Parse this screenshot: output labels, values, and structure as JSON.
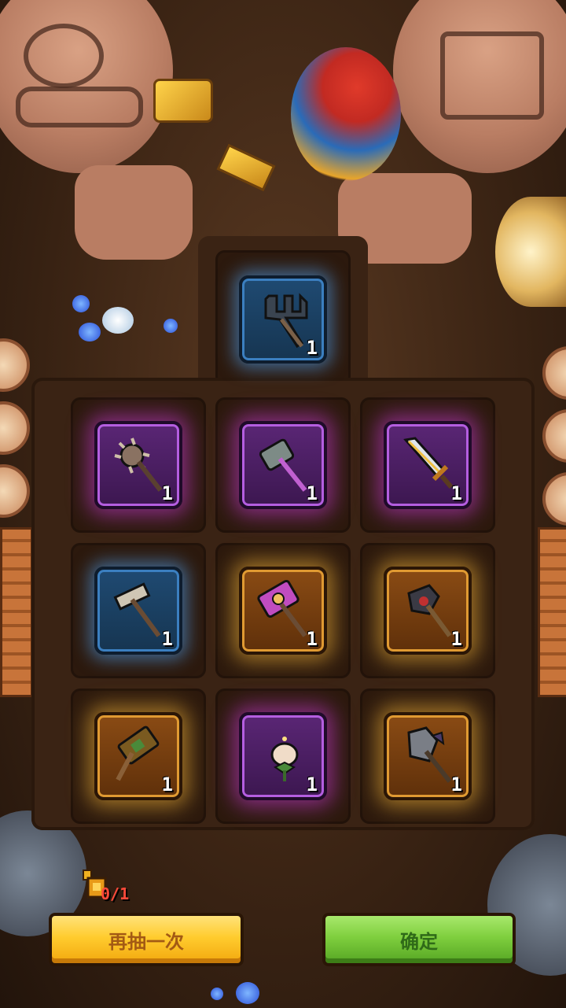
{
  "featured_item": {
    "rarity": "blue",
    "icon": "trident-icon",
    "count": "1"
  },
  "grid": [
    {
      "rarity": "purple",
      "icon": "spiked-mace-icon",
      "count": "1"
    },
    {
      "rarity": "purple",
      "icon": "war-hammer-icon",
      "count": "1"
    },
    {
      "rarity": "purple",
      "icon": "broadsword-icon",
      "count": "1"
    },
    {
      "rarity": "blue",
      "icon": "hammer-icon",
      "count": "1"
    },
    {
      "rarity": "orange",
      "icon": "ornate-hammer-icon",
      "count": "1"
    },
    {
      "rarity": "orange",
      "icon": "dark-axe-icon",
      "count": "1"
    },
    {
      "rarity": "orange",
      "icon": "golden-maul-icon",
      "count": "1"
    },
    {
      "rarity": "purple",
      "icon": "lotus-flower-icon",
      "count": "1"
    },
    {
      "rarity": "orange",
      "icon": "battle-axe-icon",
      "count": "1"
    }
  ],
  "draw_tickets": {
    "icon": "golden-key-icon",
    "count": "0/1"
  },
  "buttons": {
    "draw_again": "再抽一次",
    "confirm": "确定"
  }
}
